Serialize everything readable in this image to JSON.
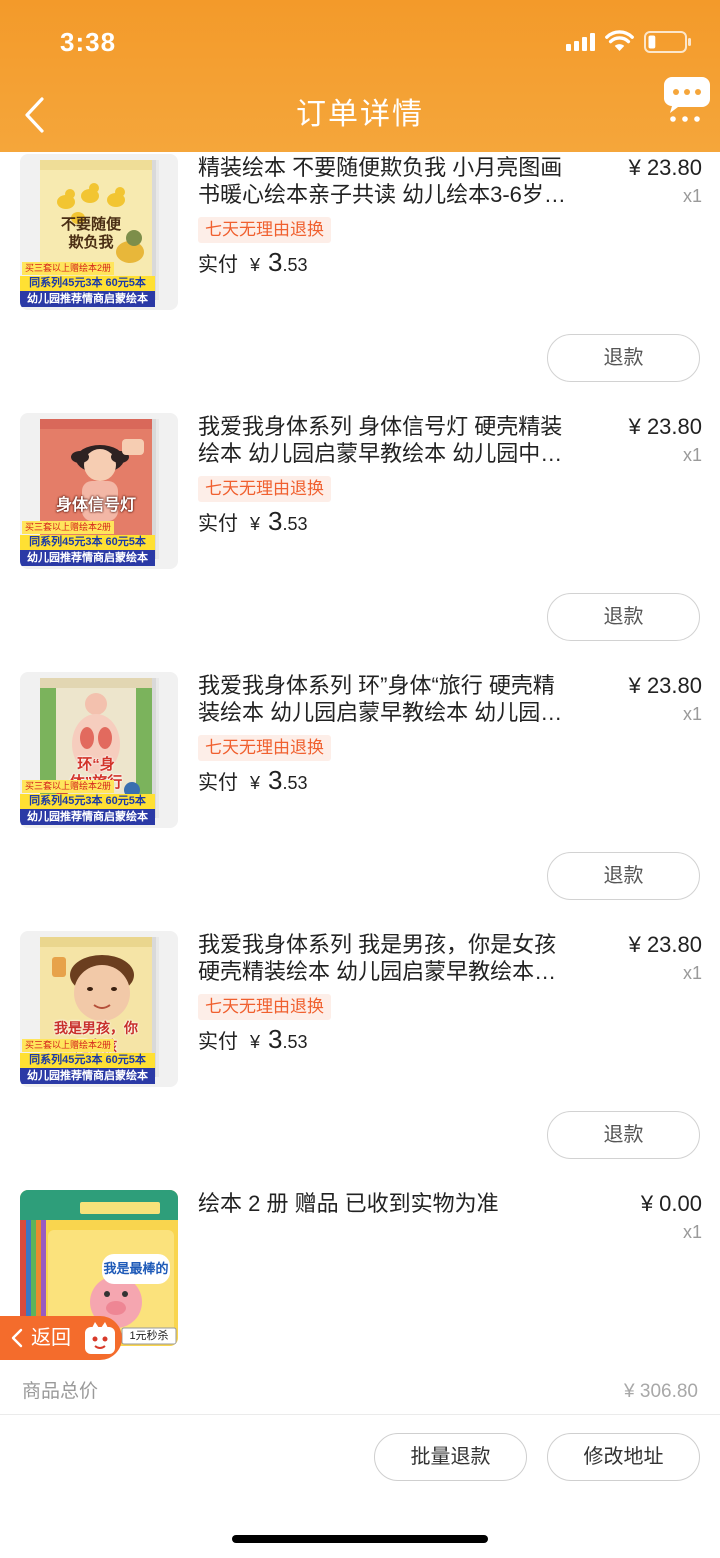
{
  "status_bar": {
    "time": "3:38",
    "battery_level": 0.2,
    "icons": [
      "signal-icon",
      "wifi-icon",
      "battery-icon"
    ]
  },
  "nav": {
    "back_icon": "chevron-left-icon",
    "title": "订单详情",
    "message_icon": "chat-bubble-icon",
    "more_icon": "more-dots-icon"
  },
  "colors": {
    "header_top": "#F39A2A",
    "header_bottom": "#F5A63B",
    "accent": "#F0602F",
    "badge_bg": "#FDEEE8",
    "float_back": "#F46C2C"
  },
  "items": [
    {
      "title_lines": [
        "精装绘本 不要随便欺负我  小月亮图画",
        "书暖心绘本亲子共读 幼儿绘本3-6岁…"
      ],
      "price": "¥ 23.80",
      "quantity": "x1",
      "tag": "七天无理由退换",
      "paid_label": "实付",
      "paid_currency": "¥",
      "paid_integer": "3",
      "paid_fraction": ".53",
      "refund_label": "退款",
      "cover": {
        "title": "不要随便欺负我",
        "promo_tag": "买三套以上赠绘本2册",
        "promo_deal": "同系列45元3本 60元5本",
        "promo_banner": "幼儿园推荐情商启蒙绘本"
      }
    },
    {
      "title_lines": [
        "我爱我身体系列 身体信号灯  硬壳精装",
        "绘本 幼儿园启蒙早教绘本 幼儿园中…"
      ],
      "price": "¥ 23.80",
      "quantity": "x1",
      "tag": "七天无理由退换",
      "paid_label": "实付",
      "paid_currency": "¥",
      "paid_integer": "3",
      "paid_fraction": ".53",
      "refund_label": "退款",
      "cover": {
        "title": "身体信号灯",
        "promo_tag": "买三套以上赠绘本2册",
        "promo_deal": "同系列45元3本 60元5本",
        "promo_banner": "幼儿园推荐情商启蒙绘本"
      }
    },
    {
      "title_lines": [
        "我爱我身体系列 环”身体“旅行 硬壳精",
        "装绘本 幼儿园启蒙早教绘本 幼儿园…"
      ],
      "price": "¥ 23.80",
      "quantity": "x1",
      "tag": "七天无理由退换",
      "paid_label": "实付",
      "paid_currency": "¥",
      "paid_integer": "3",
      "paid_fraction": ".53",
      "refund_label": "退款",
      "cover": {
        "title": "环“身体”旅行",
        "promo_tag": "买三套以上赠绘本2册",
        "promo_deal": "同系列45元3本 60元5本",
        "promo_banner": "幼儿园推荐情商启蒙绘本"
      }
    },
    {
      "title_lines": [
        "我爱我身体系列 我是男孩，你是女孩",
        "硬壳精装绘本 幼儿园启蒙早教绘本…"
      ],
      "price": "¥ 23.80",
      "quantity": "x1",
      "tag": "七天无理由退换",
      "paid_label": "实付",
      "paid_currency": "¥",
      "paid_integer": "3",
      "paid_fraction": ".53",
      "refund_label": "退款",
      "cover": {
        "title": "我是男孩，你是女孩",
        "promo_tag": "买三套以上赠绘本2册",
        "promo_deal": "同系列45元3本 60元5本",
        "promo_banner": "幼儿园推荐情商启蒙绘本"
      }
    },
    {
      "title_lines": [
        "绘本 2 册  赠品  已收到实物为准"
      ],
      "price": "¥ 0.00",
      "quantity": "x1",
      "cover": {
        "title": "我是最棒的",
        "promo_badge": "1元秒杀"
      }
    }
  ],
  "float_back": {
    "icon": "chevron-left-icon",
    "label": "返回",
    "mascot_icon": "mascot-icon"
  },
  "summary": {
    "label": "商品总价",
    "value": "¥ 306.80"
  },
  "actions": {
    "batch_refund": "批量退款",
    "change_address": "修改地址"
  }
}
